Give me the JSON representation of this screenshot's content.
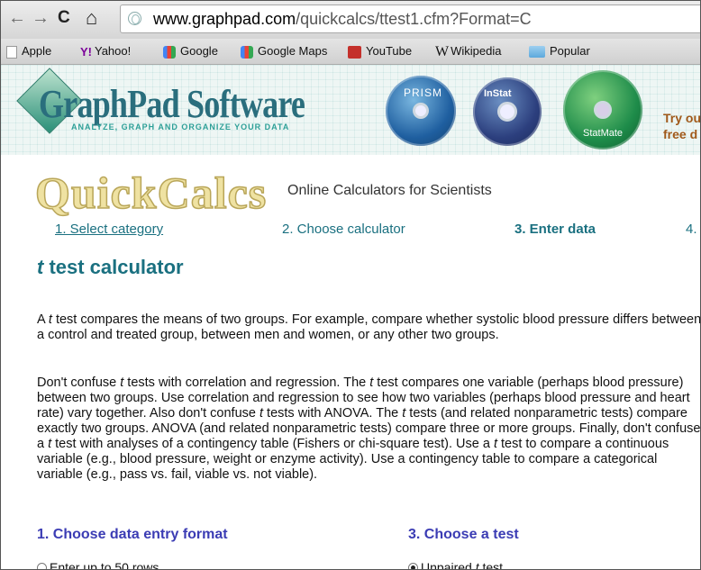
{
  "browser": {
    "nav": {
      "back": "←",
      "forward": "→",
      "reload": "C",
      "home": "⌂"
    },
    "url_host": "www.graphpad.com",
    "url_path": "/quickcalcs/ttest1.cfm?Format=C",
    "bookmarks": [
      "Apple",
      "Yahoo!",
      "Google",
      "Google Maps",
      "YouTube",
      "Wikipedia",
      "Popular"
    ]
  },
  "banner": {
    "logo": "GraphPad Software",
    "tagline": "ANALYZE, GRAPH AND ORGANIZE YOUR DATA",
    "products": [
      "PRISM",
      "InStat",
      "StatMate"
    ],
    "try_line1": "Try ou",
    "try_line2": "free d"
  },
  "quickcalcs": {
    "title": "QuickCalcs",
    "subtitle": "Online Calculators for Scientists"
  },
  "steps": [
    "1. Select category",
    "2. Choose calculator",
    "3. Enter data",
    "4."
  ],
  "page_title_t": "t",
  "page_title_rest": " test calculator",
  "paragraphs": {
    "p1_a": "A ",
    "p1_t": "t",
    "p1_b": "  test compares the means of two groups. For example, compare whether systolic blood pressure differs between a control and treated group, between men and women, or any other two groups.",
    "p2_a": "Don't confuse ",
    "p2_t1": "t",
    "p2_b": "  tests with correlation and regression. The ",
    "p2_t2": "t",
    "p2_c": " test compares one variable (perhaps blood pressure) between two groups. Use correlation and regression to see how two variables (perhaps blood pressure and heart rate) vary together. Also don't confuse ",
    "p2_t3": "t",
    "p2_d": "  tests with ANOVA. The ",
    "p2_t4": "t",
    "p2_e": "  tests (and related nonparametric tests) compare exactly two groups. ANOVA (and related nonparametric tests) compare three or more groups. Finally, don't confuse a ",
    "p2_t5": "t",
    "p2_f": " test with analyses of a contingency table (Fishers or chi-square test). Use a ",
    "p2_t6": "t",
    "p2_g": "  test to compare a continuous variable (e.g., blood pressure, weight or enzyme activity). Use a contingency table to compare a categorical variable (e.g., pass vs. fail, viable vs. not viable)."
  },
  "sections": {
    "s1": "1. Choose data entry format",
    "s3": "3. Choose a test",
    "opt1": "Enter up to 50 rows.",
    "opt3_a": "Unpaired ",
    "opt3_t": "t",
    "opt3_b": " test."
  },
  "colors": {
    "step_link": "#1a7080",
    "active_step": "#1a7080",
    "section": "#3b3cb4"
  }
}
